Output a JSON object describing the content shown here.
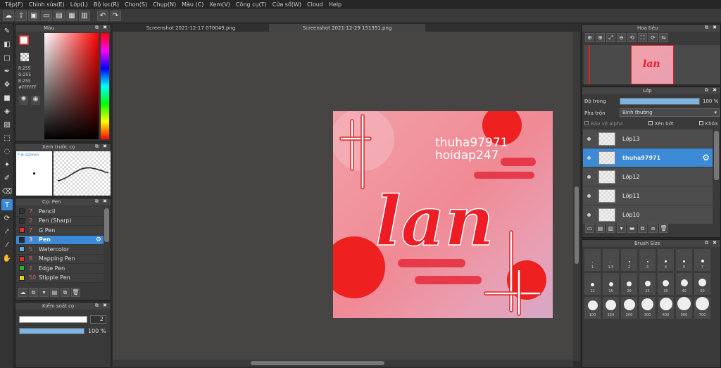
{
  "menu": [
    "Tệp(F)",
    "Chỉnh sửa(E)",
    "Lớp(L)",
    "Bộ lọc(R)",
    "Chọn(S)",
    "Chụp(N)",
    "Màu (C)",
    "Xem(V)",
    "Công cụ(T)",
    "Cửa sổ(W)",
    "Cloud",
    "Help"
  ],
  "tabs": [
    "Screenshot 2021-12-17 070049.png",
    "Screenshot 2021-12-29 151351.png"
  ],
  "color_panel": {
    "title": "Màu",
    "r": "R:255",
    "g": "G:255",
    "b": "B:255",
    "hex": "#FFFFFF"
  },
  "preview_panel": {
    "title": "Xem trước cọ",
    "size": "* 6.42mm"
  },
  "brush_panel": {
    "title": "Cọ: Pen",
    "items": [
      {
        "num": "7",
        "name": "Pencil",
        "color": "#333333"
      },
      {
        "num": "2",
        "name": "Pen (Sharp)",
        "color": "#333333"
      },
      {
        "num": "7",
        "name": "G Pen",
        "color": "#e03030"
      },
      {
        "num": "3",
        "name": "Pen",
        "color": "#2a2a2a"
      },
      {
        "num": "5",
        "name": "Watercolor",
        "color": "#5ab0e0"
      },
      {
        "num": "8",
        "name": "Mapping Pen",
        "color": "#e03030"
      },
      {
        "num": "2",
        "name": "Edge Pen",
        "color": "#30b030"
      },
      {
        "num": "50",
        "name": "Stipple Pen",
        "color": "#e0d020"
      }
    ]
  },
  "control_panel": {
    "title": "Kiểm soát cọ",
    "size_value": "2",
    "opacity_value": "100 %"
  },
  "navigator": {
    "title": "Hoa tiêu"
  },
  "layer_panel": {
    "title": "Lớp",
    "opacity_label": "Độ trong",
    "opacity_value": "100 %",
    "blend_label": "Pha trộn",
    "blend_value": "Bình thường",
    "checks": [
      "Bảo vệ alpha",
      "Xén bớt",
      "Khóa"
    ],
    "layers": [
      "Lớp13",
      "thuha97971",
      "Lớp12",
      "Lớp11",
      "Lớp10"
    ]
  },
  "brush_size": {
    "title": "Brush Size",
    "row1": [
      "1",
      "1.5",
      "2",
      "3",
      "4",
      "5",
      "7"
    ],
    "row2": [
      "12",
      "15",
      "20",
      "25",
      "30",
      "40",
      "50"
    ],
    "row3": [
      "100",
      "150",
      "200",
      "300",
      "400",
      "500",
      "700"
    ]
  },
  "artwork": {
    "line1": "thuha97971",
    "line2": "hoidap247",
    "word": "lan"
  }
}
